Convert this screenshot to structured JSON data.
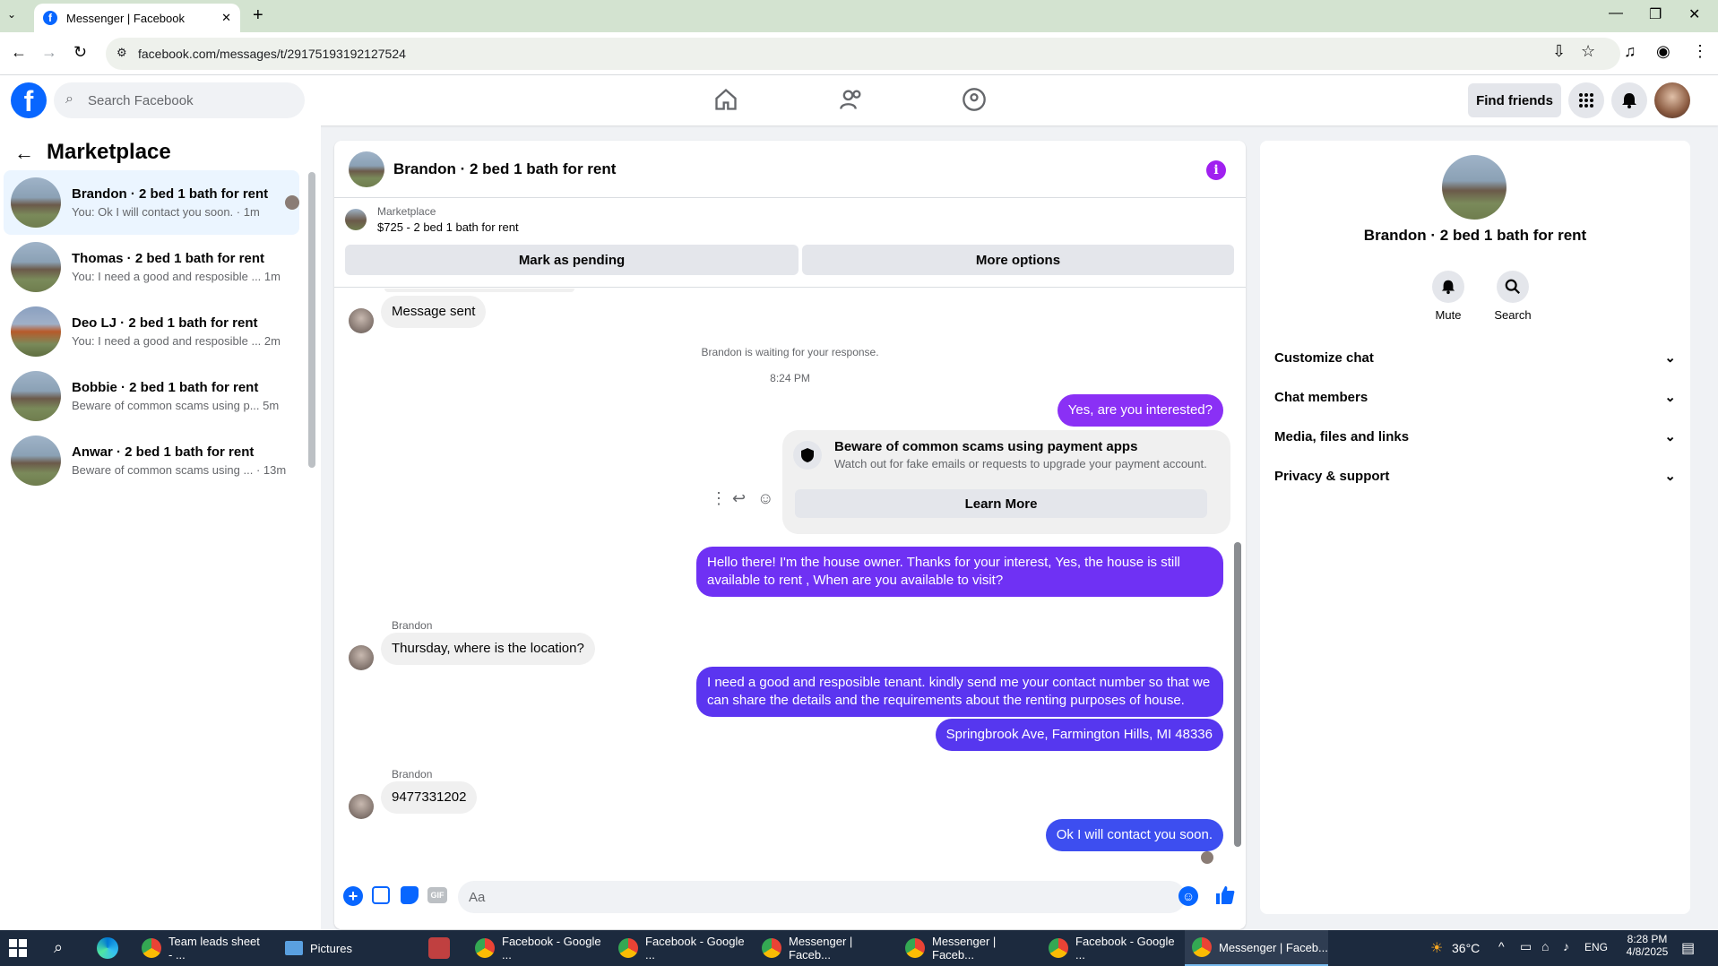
{
  "browser": {
    "tab_title": "Messenger | Facebook",
    "url": "facebook.com/messages/t/29175193192127524"
  },
  "header": {
    "search_placeholder": "Search Facebook",
    "find_friends": "Find friends"
  },
  "sidebar": {
    "title": "Marketplace",
    "conversations": [
      {
        "name": "Brandon · 2 bed 1 bath for rent",
        "preview": "You: Ok I will contact you soon. · 1m",
        "active": true
      },
      {
        "name": "Thomas · 2 bed 1 bath for rent",
        "preview": "You: I need a good and resposible ...",
        "time": "1m"
      },
      {
        "name": "Deo LJ · 2 bed 1 bath for rent",
        "preview": "You: I need a good and resposible ...",
        "time": "2m"
      },
      {
        "name": "Bobbie · 2 bed 1 bath for rent",
        "preview": "Beware of common scams using p...",
        "time": "5m"
      },
      {
        "name": "Anwar · 2 bed 1 bath for rent",
        "preview": "Beware of common scams using ...",
        "time": "· 13m"
      }
    ]
  },
  "chat": {
    "title": "Brandon · 2 bed 1 bath for rent",
    "listing_source": "Marketplace",
    "listing_title": "$725 - 2 bed 1 bath for rent",
    "mark_pending": "Mark as pending",
    "more_options": "More options",
    "messages": {
      "sent_note": "Message sent",
      "waiting": "Brandon is waiting for your response.",
      "time": "8:24 PM",
      "m1": "Yes, are you interested?",
      "scam_title": "Beware of common scams using payment apps",
      "scam_sub": "Watch out for fake emails or requests to upgrade your payment account.",
      "learn_more": "Learn More",
      "m2": "Hello there! I'm the house owner. Thanks for your interest, Yes, the house is still available to rent , When are you available to visit?",
      "sender1": "Brandon",
      "m3": "Thursday, where is the location?",
      "m4": "I need a good and resposible tenant.  kindly send me your contact number so that we can share the details and the requirements about the renting purposes of house.",
      "m5": "Springbrook Ave, Farmington Hills, MI 48336",
      "sender2": "Brandon",
      "m6": "9477331202",
      "m7": "Ok I will contact you soon."
    },
    "composer_placeholder": "Aa"
  },
  "details": {
    "name": "Brandon · 2 bed 1 bath for rent",
    "mute": "Mute",
    "search": "Search",
    "sections": [
      "Customize chat",
      "Chat members",
      "Media, files and links",
      "Privacy & support"
    ]
  },
  "taskbar": {
    "apps": [
      "Team leads sheet - ...",
      "Pictures",
      "Facebook - Google ...",
      "Facebook - Google ...",
      "Messenger | Faceb...",
      "Messenger | Faceb...",
      "Facebook - Google ...",
      "Messenger | Faceb..."
    ],
    "temp": "36°C",
    "lang": "ENG",
    "clock_time": "8:28 PM",
    "clock_date": "4/8/2025"
  },
  "colors": {
    "fb_blue": "#0866ff",
    "bubble_purple": "#6f31f4",
    "info_purple": "#a020f0"
  }
}
